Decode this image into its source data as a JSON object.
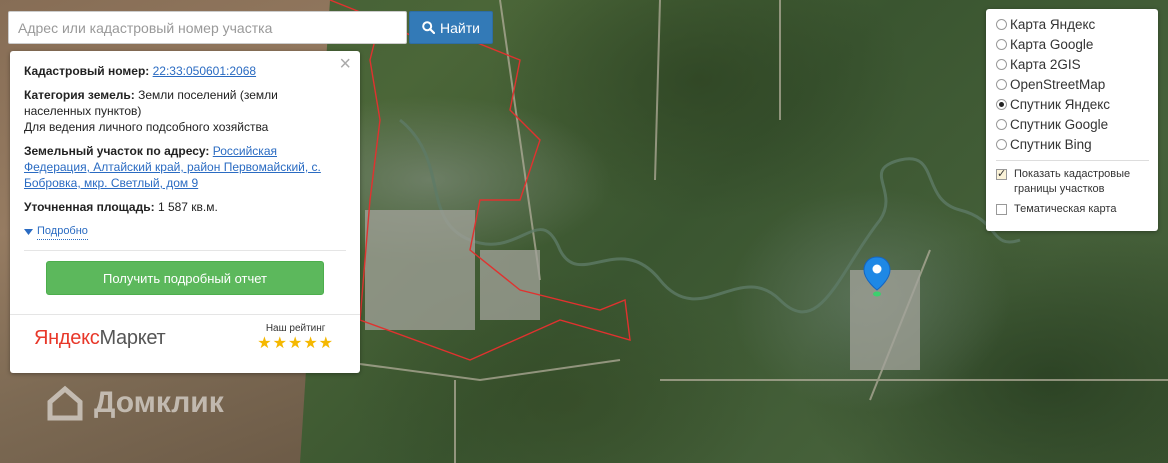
{
  "search": {
    "placeholder": "Адрес или кадастровый номер участка",
    "button_label": "Найти"
  },
  "info": {
    "cadastral_label": "Кадастровый номер:",
    "cadastral_number": "22:33:050601:2068",
    "category_label": "Категория земель:",
    "category_value": "Земли поселений (земли населенных пунктов)",
    "usage": "Для ведения личного подсобного хозяйства",
    "address_label": "Земельный участок по адресу:",
    "address_value": "Российская Федерация, Алтайский край, район Первомайский, с. Бобровка, мкр. Светлый, дом 9",
    "area_label": "Уточненная площадь:",
    "area_value": "1 587 кв.м.",
    "details_label": "Подробно",
    "report_button": "Получить подробный отчет",
    "market_logo_y": "Яндекс",
    "market_logo_m": "Маркет",
    "rating_label": "Наш рейтинг",
    "rating_stars": "★★★★★",
    "rating_value": 5
  },
  "layers": {
    "items": [
      {
        "label": "Карта Яндекс",
        "selected": false
      },
      {
        "label": "Карта Google",
        "selected": false
      },
      {
        "label": "Карта 2GIS",
        "selected": false
      },
      {
        "label": "OpenStreetMap",
        "selected": false
      },
      {
        "label": "Спутник Яндекс",
        "selected": true
      },
      {
        "label": "Спутник Google",
        "selected": false
      },
      {
        "label": "Спутник Bing",
        "selected": false
      }
    ],
    "cadastral_borders_label": "Показать кадастровые границы участков",
    "cadastral_borders_checked": true,
    "thematic_label": "Тематическая карта",
    "thematic_checked": false
  },
  "watermark": {
    "text": "Домклик"
  },
  "colors": {
    "search_button": "#337ab7",
    "report_button": "#5cb85c",
    "link": "#2a6bc2",
    "marker": "#1e88e5",
    "cadastral_border": "#e0322f"
  }
}
